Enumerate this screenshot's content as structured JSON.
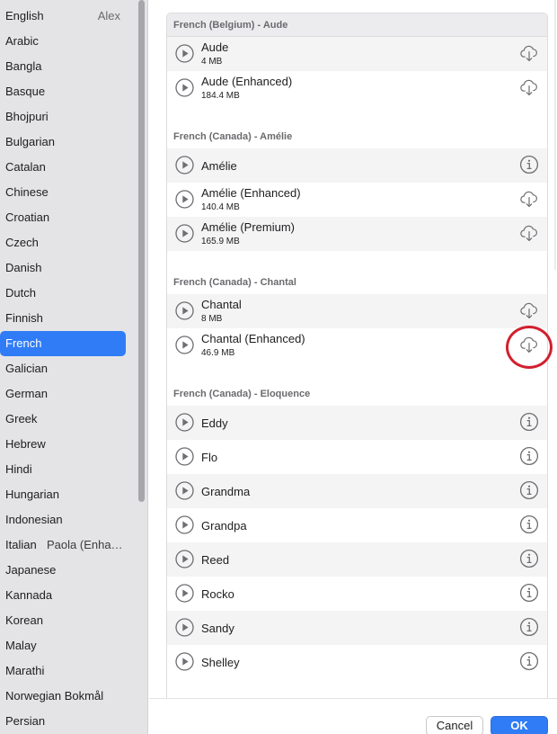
{
  "sidebar": {
    "items": [
      {
        "label": "English",
        "voice": "Alex",
        "voice_align": "right"
      },
      {
        "label": "Arabic"
      },
      {
        "label": "Bangla"
      },
      {
        "label": "Basque"
      },
      {
        "label": "Bhojpuri"
      },
      {
        "label": "Bulgarian"
      },
      {
        "label": "Catalan"
      },
      {
        "label": "Chinese"
      },
      {
        "label": "Croatian"
      },
      {
        "label": "Czech"
      },
      {
        "label": "Danish"
      },
      {
        "label": "Dutch"
      },
      {
        "label": "Finnish"
      },
      {
        "label": "French",
        "selected": true
      },
      {
        "label": "Galician"
      },
      {
        "label": "German"
      },
      {
        "label": "Greek"
      },
      {
        "label": "Hebrew"
      },
      {
        "label": "Hindi"
      },
      {
        "label": "Hungarian"
      },
      {
        "label": "Indonesian"
      },
      {
        "label": "Italian",
        "voice": "Paola (Enha…",
        "voice_align": "left"
      },
      {
        "label": "Japanese"
      },
      {
        "label": "Kannada"
      },
      {
        "label": "Korean"
      },
      {
        "label": "Malay"
      },
      {
        "label": "Marathi"
      },
      {
        "label": "Norwegian Bokmål"
      },
      {
        "label": "Persian"
      }
    ]
  },
  "voices": {
    "sections": [
      {
        "title": "French (Belgium) - Aude",
        "rows": [
          {
            "name": "Aude",
            "size": "4 MB",
            "action": "download-icon"
          },
          {
            "name": "Aude (Enhanced)",
            "size": "184.4 MB",
            "action": "download-icon"
          }
        ]
      },
      {
        "title": "French (Canada) - Amélie",
        "rows": [
          {
            "name": "Amélie",
            "action": "info-icon"
          },
          {
            "name": "Amélie (Enhanced)",
            "size": "140.4 MB",
            "action": "download-icon"
          },
          {
            "name": "Amélie (Premium)",
            "size": "165.9 MB",
            "action": "download-icon"
          }
        ]
      },
      {
        "title": "French (Canada) - Chantal",
        "rows": [
          {
            "name": "Chantal",
            "size": "8 MB",
            "action": "download-icon"
          },
          {
            "name": "Chantal (Enhanced)",
            "size": "46.9 MB",
            "action": "download-icon"
          }
        ]
      },
      {
        "title": "French (Canada) - Eloquence",
        "rows": [
          {
            "name": "Eddy",
            "action": "info-icon"
          },
          {
            "name": "Flo",
            "action": "info-icon"
          },
          {
            "name": "Grandma",
            "action": "info-icon"
          },
          {
            "name": "Grandpa",
            "action": "info-icon"
          },
          {
            "name": "Reed",
            "action": "info-icon"
          },
          {
            "name": "Rocko",
            "action": "info-icon"
          },
          {
            "name": "Sandy",
            "action": "info-icon"
          },
          {
            "name": "Shelley",
            "action": "info-icon"
          }
        ]
      }
    ]
  },
  "buttons": {
    "cancel_label": "Cancel",
    "ok_label": "OK"
  },
  "colors": {
    "accent": "#2f7cf6",
    "highlight": "#d2202e"
  }
}
